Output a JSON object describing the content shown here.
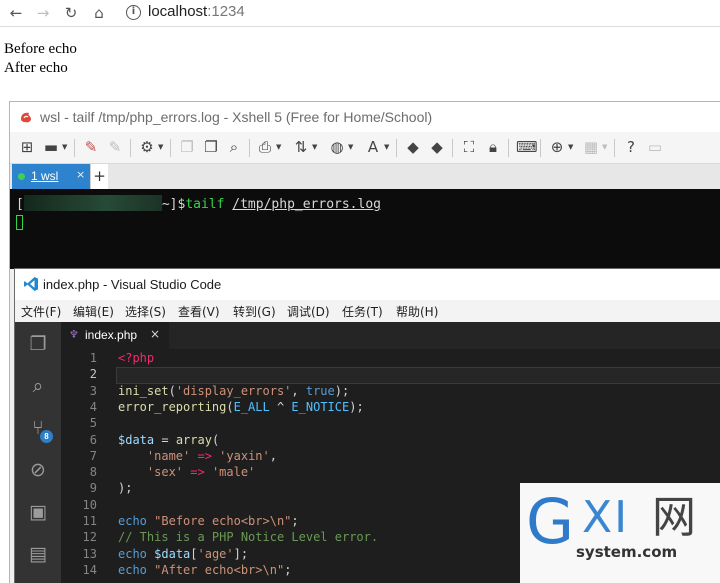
{
  "browser": {
    "back_icon": "←",
    "forward_icon": "→",
    "reload_icon": "↻",
    "home_icon": "⌂",
    "info_icon": "i",
    "url_host": "localhost",
    "url_port": ":1234"
  },
  "page_output": {
    "line1": "Before echo",
    "line2": "After echo"
  },
  "xshell": {
    "title": "wsl - tailf /tmp/php_errors.log - Xshell 5 (Free for Home/School)",
    "tab_label": "1 wsl",
    "tab_close": "×",
    "tab_add": "+",
    "terminal": {
      "prompt_open": "[",
      "prompt_tail": "~]$",
      "command": "tailf",
      "argument": "/tmp/php_errors.log"
    },
    "accent_color": "#2e83cf"
  },
  "vscode": {
    "title": "index.php - Visual Studio Code",
    "menu": [
      "文件(F)",
      "编辑(E)",
      "选择(S)",
      "查看(V)",
      "转到(G)",
      "调试(D)",
      "任务(T)",
      "帮助(H)"
    ],
    "scm_badge": "8",
    "tab_label": "index.php",
    "tab_close": "×",
    "lines": {
      "n1": "1",
      "n2": "2",
      "n3": "3",
      "n4": "4",
      "n5": "5",
      "n6": "6",
      "n7": "7",
      "n8": "8",
      "n9": "9",
      "n10": "10",
      "n11": "11",
      "n12": "12",
      "n13": "13",
      "n14": "14"
    },
    "code": {
      "l1_open": "<?php",
      "l3_fn": "ini_set",
      "l3_p1": "(",
      "l3_s1": "'display_errors'",
      "l3_comma": ", ",
      "l3_true": "true",
      "l3_end": ");",
      "l4_fn": "error_reporting",
      "l4_p1": "(",
      "l4_c1": "E_ALL",
      "l4_op": " ^ ",
      "l4_c2": "E_NOTICE",
      "l4_end": ");",
      "l6_var": "$data",
      "l6_eq": " = ",
      "l6_arr": "array",
      "l6_p": "(",
      "l7_indent": "    ",
      "l7_k": "'name'",
      "l7_arrow": " => ",
      "l7_v": "'yaxin'",
      "l7_comma": ",",
      "l8_indent": "    ",
      "l8_k": "'sex'",
      "l8_arrow": " => ",
      "l8_v": "'male'",
      "l9": ");",
      "l11_echo": "echo",
      "l11_sp": " ",
      "l11_str": "\"Before echo<br>\\n\"",
      "l11_end": ";",
      "l12_cmt": "// This is a PHP Notice Level error.",
      "l13_echo": "echo",
      "l13_sp": " ",
      "l13_var": "$data",
      "l13_idx_open": "[",
      "l13_key": "'age'",
      "l13_idx_close": "]",
      "l13_end": ";",
      "l14_echo": "echo",
      "l14_sp": " ",
      "l14_str": "\"After echo<br>\\n\"",
      "l14_end": ";"
    }
  },
  "watermark": {
    "g": "G",
    "xi": "XI",
    "wang": "网",
    "site": "system.com"
  }
}
